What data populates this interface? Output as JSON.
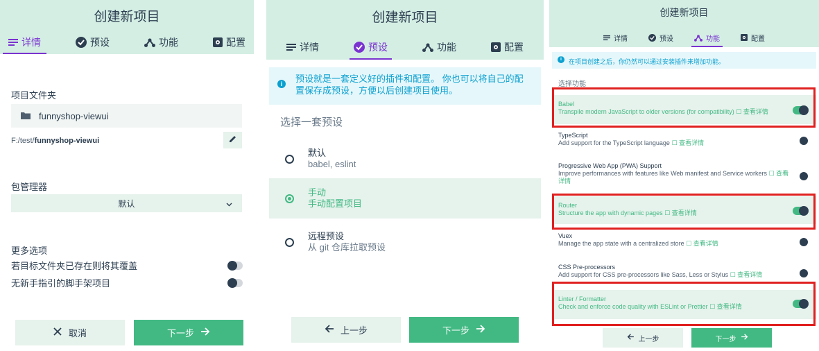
{
  "panel1": {
    "title": "创建新项目",
    "tabs": [
      {
        "label": "详情",
        "icon": "list-icon",
        "active": true
      },
      {
        "label": "预设",
        "icon": "check-circle-icon",
        "active": false
      },
      {
        "label": "功能",
        "icon": "fork-icon",
        "active": false
      },
      {
        "label": "配置",
        "icon": "gear-box-icon",
        "active": false
      }
    ],
    "folder_label": "项目文件夹",
    "folder_value": "funnyshop-viewui",
    "path_prefix": "F:/test/",
    "path_name": "funnyshop-viewui",
    "pm_label": "包管理器",
    "pm_value": "默认",
    "more_label": "更多选项",
    "options": [
      {
        "label": "若目标文件夹已存在则将其覆盖",
        "on": false
      },
      {
        "label": "无新手指引的脚手架项目",
        "on": false
      }
    ],
    "cancel": "取消",
    "next": "下一步"
  },
  "panel2": {
    "title": "创建新项目",
    "tabs": [
      {
        "label": "详情",
        "active": false
      },
      {
        "label": "预设",
        "active": true
      },
      {
        "label": "功能",
        "active": false
      },
      {
        "label": "配置",
        "active": false
      }
    ],
    "info": "预设就是一套定义好的插件和配置。 你也可以将自己的配置保存成预设，方便以后创建项目使用。",
    "section": "选择一套预设",
    "presets": [
      {
        "name": "默认",
        "desc": "babel, eslint",
        "selected": false
      },
      {
        "name": "手动",
        "desc": "手动配置项目",
        "selected": true
      },
      {
        "name": "远程预设",
        "desc": "从 git 仓库拉取预设",
        "selected": false
      }
    ],
    "prev": "上一步",
    "next": "下一步"
  },
  "panel3": {
    "title": "创建新项目",
    "tabs": [
      {
        "label": "详情",
        "active": false
      },
      {
        "label": "预设",
        "active": false
      },
      {
        "label": "功能",
        "active": true
      },
      {
        "label": "配置",
        "active": false
      }
    ],
    "info": "在项目创建之后，你仍然可以通过安装插件来增加功能。",
    "section": "选择功能",
    "link_label": "查看详情",
    "features": [
      {
        "name": "Babel",
        "desc": "Transpile modern JavaScript to older versions (for compatibility)",
        "on": true
      },
      {
        "name": "TypeScript",
        "desc": "Add support for the TypeScript language",
        "on": false
      },
      {
        "name": "Progressive Web App (PWA) Support",
        "desc": "Improve performances with features like Web manifest and Service workers",
        "on": false
      },
      {
        "name": "Router",
        "desc": "Structure the app with dynamic pages",
        "on": true
      },
      {
        "name": "Vuex",
        "desc": "Manage the app state with a centralized store",
        "on": false
      },
      {
        "name": "CSS Pre-processors",
        "desc": "Add support for CSS pre-processors like Sass, Less or Stylus",
        "on": false
      },
      {
        "name": "Linter / Formatter",
        "desc": "Check and enforce code quality with ESLint or Prettier",
        "on": true
      }
    ],
    "prev": "上一步",
    "next": "下一步"
  },
  "colors": {
    "accent": "#42b983",
    "active_tab": "#7b33d0",
    "header_bg": "#d4eee4",
    "info": "#0aa0d0",
    "highlight": "#e02020"
  }
}
